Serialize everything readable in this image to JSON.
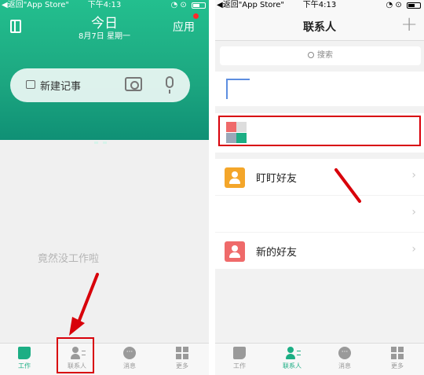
{
  "left": {
    "status": {
      "back": "◀返回\"App Store\"",
      "time": "下午4:13"
    },
    "header": {
      "title": "今日",
      "date": "8月7日 星期一",
      "apps_label": "应用"
    },
    "input": {
      "placeholder": "新建记事"
    },
    "empty_text": "竟然没工作啦",
    "tabs": [
      {
        "label": "工作",
        "icon": "work-icon"
      },
      {
        "label": "联系人",
        "icon": "contacts-icon"
      },
      {
        "label": "消息",
        "icon": "message-icon"
      },
      {
        "label": "更多",
        "icon": "more-icon"
      }
    ]
  },
  "right": {
    "status": {
      "back": "◀返回\"App Store\"",
      "time": "下午4:13"
    },
    "header": {
      "title": "联系人",
      "add_icon": "plus-icon"
    },
    "search": {
      "placeholder": "搜索"
    },
    "rows": [
      {
        "label": "盯盯好友",
        "color": "#f4a62a"
      },
      {
        "label": "",
        "color": ""
      },
      {
        "label": "新的好友",
        "color": "#ef6a6a"
      }
    ],
    "tabs": [
      {
        "label": "工作",
        "icon": "work-icon"
      },
      {
        "label": "联系人",
        "icon": "contacts-icon"
      },
      {
        "label": "消息",
        "icon": "message-icon"
      },
      {
        "label": "更多",
        "icon": "more-icon"
      }
    ]
  },
  "colors": {
    "brand": "#1cae84",
    "annotation": "#d8000a"
  }
}
